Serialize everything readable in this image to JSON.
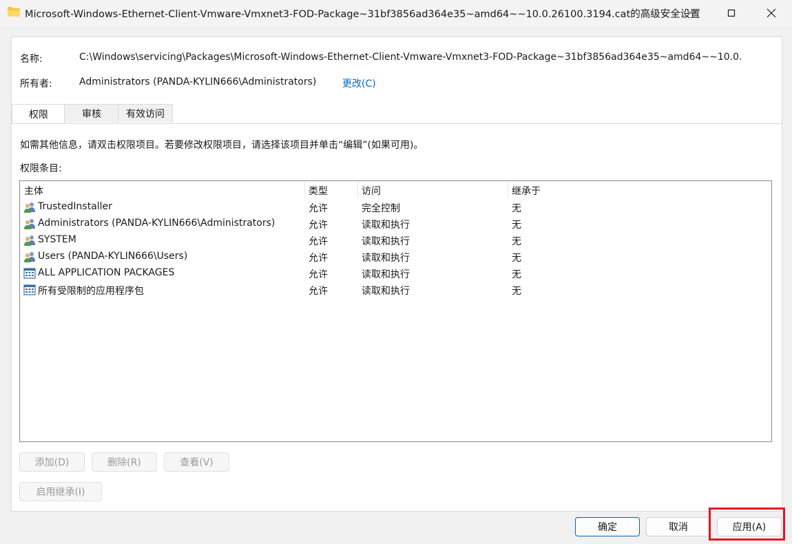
{
  "window": {
    "title": "Microsoft-Windows-Ethernet-Client-Vmware-Vmxnet3-FOD-Package~31bf3856ad364e35~amd64~~10.0.26100.3194.cat的高级安全设置",
    "icon": "folder-icon"
  },
  "info": {
    "name_label": "名称:",
    "name_value": "C:\\Windows\\servicing\\Packages\\Microsoft-Windows-Ethernet-Client-Vmware-Vmxnet3-FOD-Package~31bf3856ad364e35~amd64~~10.0.",
    "owner_label": "所有者:",
    "owner_value": "Administrators (PANDA-KYLIN666\\Administrators)",
    "change_link": "更改(C)"
  },
  "tabs": [
    {
      "label": "权限",
      "active": true
    },
    {
      "label": "审核",
      "active": false
    },
    {
      "label": "有效访问",
      "active": false
    }
  ],
  "permissions": {
    "hint": "如需其他信息，请双击权限项目。若要修改权限项目，请选择该项目并单击“编辑”(如果可用)。",
    "entries_label": "权限条目:",
    "columns": [
      "主体",
      "类型",
      "访问",
      "继承于"
    ],
    "rows": [
      {
        "principal": "TrustedInstaller",
        "type": "允许",
        "access": "完全控制",
        "inherited": "无",
        "icon": "users-icon"
      },
      {
        "principal": "Administrators (PANDA-KYLIN666\\Administrators)",
        "type": "允许",
        "access": "读取和执行",
        "inherited": "无",
        "icon": "users-icon"
      },
      {
        "principal": "SYSTEM",
        "type": "允许",
        "access": "读取和执行",
        "inherited": "无",
        "icon": "users-icon"
      },
      {
        "principal": "Users (PANDA-KYLIN666\\Users)",
        "type": "允许",
        "access": "读取和执行",
        "inherited": "无",
        "icon": "users-icon"
      },
      {
        "principal": "ALL APPLICATION PACKAGES",
        "type": "允许",
        "access": "读取和执行",
        "inherited": "无",
        "icon": "app-package-icon"
      },
      {
        "principal": "所有受限制的应用程序包",
        "type": "允许",
        "access": "读取和执行",
        "inherited": "无",
        "icon": "app-package-icon"
      }
    ]
  },
  "buttons": {
    "add": "添加(D)",
    "remove": "删除(R)",
    "view": "查看(V)",
    "enable_inheritance": "启用继承(I)",
    "ok": "确定",
    "cancel": "取消",
    "apply": "应用(A)"
  },
  "colors": {
    "link": "#0066cc",
    "highlight": "#e81123",
    "primary_border": "#005fb8"
  }
}
